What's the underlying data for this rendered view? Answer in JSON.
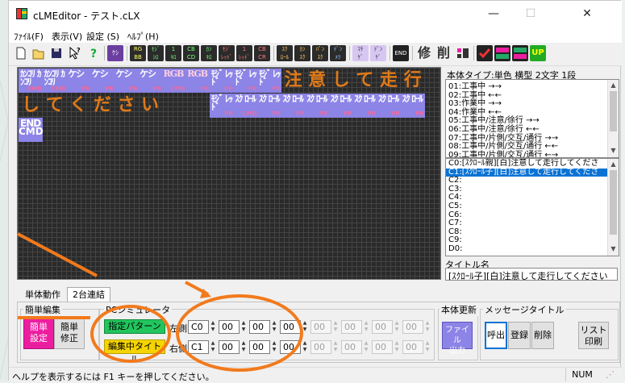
{
  "window": {
    "title": "cLMEditor - テスト.cLX",
    "minimize_glyph": "—",
    "maximize_glyph": "☐",
    "close_glyph": "✕"
  },
  "menu": [
    "ﾌｧｲﾙ(F)",
    "表示(V)",
    "設定 (S)",
    "ﾍﾙﾌﾟ(H)"
  ],
  "toolbar": {
    "icons": [
      "new-file-icon",
      "open-file-icon",
      "save-icon",
      "help-pointer-icon",
      "question-icon",
      "kesi-icon",
      "rgb-icon",
      "moji-icon",
      "one-icon",
      "cd-icon",
      "ka-icon",
      "moji-red-icon",
      "one-red-icon",
      "cr-icon",
      "scroll-icon",
      "ka-red-icon",
      "scroll-red-icon",
      "scroll-blue-icon",
      "sheet-icon",
      "end-icon",
      "edit-icon",
      "delete-icon",
      "layout-icon",
      "check-icon",
      "settings-icon",
      "down-icon",
      "up-icon"
    ],
    "end_label": "END",
    "edit_label": "修",
    "delete_label": "削",
    "up_label": "UP"
  },
  "grid_cells": [
    {
      "text": "ｶﾝｺﾘ ｶﾝｺﾘ",
      "tag": "CMD",
      "style": "p"
    },
    {
      "text": "ｶﾝｺﾘ ｶﾝｺﾘ",
      "tag": "CMD",
      "style": "p"
    },
    {
      "text": "ケシ",
      "tag": "PR",
      "style": "p"
    },
    {
      "text": "ケシ",
      "tag": "PR",
      "style": "p"
    },
    {
      "text": "ケシ",
      "tag": "PR",
      "style": "p"
    },
    {
      "text": "ケシ",
      "tag": "PR",
      "style": "p"
    },
    {
      "text": "RGB",
      "tag": "CMD",
      "style": "p rg"
    },
    {
      "text": "RGB",
      "tag": "PR",
      "style": "p rg"
    },
    {
      "text": "ﾓｼﾞ ﾚｯﾄﾞ",
      "tag": "PR",
      "style": "p"
    },
    {
      "text": "ﾓｼﾞ ﾚｯﾄﾞ",
      "tag": "PR",
      "style": "p"
    },
    {
      "text": "ﾓｼﾞ ﾚｯﾄﾞ",
      "tag": "PR",
      "style": "p"
    },
    {
      "text": "注",
      "tag": "",
      "style": "o"
    },
    {
      "text": "意",
      "tag": "",
      "style": "o"
    },
    {
      "text": "し",
      "tag": "",
      "style": "o"
    },
    {
      "text": "て",
      "tag": "",
      "style": "o"
    },
    {
      "text": "走",
      "tag": "",
      "style": "o"
    },
    {
      "text": "行",
      "tag": "",
      "style": "o"
    },
    {
      "text": "し",
      "tag": "",
      "style": "o"
    },
    {
      "text": "て",
      "tag": "",
      "style": "o"
    },
    {
      "text": "く",
      "tag": "",
      "style": "o"
    },
    {
      "text": "だ",
      "tag": "",
      "style": "o"
    },
    {
      "text": "さ",
      "tag": "",
      "style": "o"
    },
    {
      "text": "い",
      "tag": "",
      "style": "o"
    },
    {
      "text": "",
      "tag": "",
      "style": "blank"
    },
    {
      "text": "",
      "tag": "",
      "style": "blank"
    },
    {
      "text": "ﾓｼﾞ ﾚｯﾄﾞ",
      "tag": "PR",
      "style": "p"
    },
    {
      "text": "ｽｸ ﾛｰﾙ",
      "tag": "CMD",
      "style": "p"
    },
    {
      "text": "ｽｸ ﾛｰﾙ",
      "tag": "PR",
      "style": "p"
    },
    {
      "text": "ｽｸ ﾛｰﾙ",
      "tag": "PR",
      "style": "p"
    },
    {
      "text": "ｽｸ ﾛｰﾙ",
      "tag": "PR",
      "style": "p"
    },
    {
      "text": "ｽｸ ﾛｰﾙ",
      "tag": "PR",
      "style": "p"
    },
    {
      "text": "ｽｸ ﾛｰﾙ",
      "tag": "PR",
      "style": "p"
    },
    {
      "text": "ｽｸ ﾛｰﾙ",
      "tag": "PR",
      "style": "p"
    },
    {
      "text": "ｽｸ ﾛｰﾙ",
      "tag": "PR",
      "style": "p"
    },
    {
      "text": "END",
      "tag": "CMD",
      "style": "end"
    }
  ],
  "right_panel": {
    "type_label": "本体タイプ:単色 横型 2文字 1段",
    "patterns": [
      "01:工事中 →→",
      "02:工事中 ←←",
      "03:作業中 →→",
      "04:作業中 ←←",
      "05:工事中/注意/徐行 →→",
      "06:工事中/注意/徐行 ←←",
      "07:工事中/片側/交互/通行 →→",
      "08:工事中/片側/交互/通行 ←←",
      "09:工事中/片側/交互/通行 ←→"
    ],
    "titles": [
      "C0:[ｽｸﾛｰﾙ親][白]注意して走行してくださ",
      "C1:[ｽｸﾛｰﾙ子][白]注意して走行してくださ",
      "C2:",
      "C3:",
      "C4:",
      "C5:",
      "C6:",
      "C7:",
      "C8:",
      "C9:",
      "D0:"
    ],
    "title_name_label": "タイトル名",
    "title_name_value": "[ｽｸﾛｰﾙ子][白]注意して走行してください"
  },
  "tabs": [
    "単体動作",
    "2台連結"
  ],
  "simple_edit": {
    "group_label": "簡単編集",
    "settings_button": "簡単\n設定",
    "fix_button": "簡単\n修正"
  },
  "pc_sim": {
    "group_label": "PCシミュレータ",
    "specified_pattern_button": "指定パターン",
    "editing_title_button": "編集中タイトル",
    "left_label": "左側",
    "right_label": "右側",
    "left_values": [
      "C0",
      "00",
      "00",
      "00",
      "00",
      "00",
      "00",
      "00"
    ],
    "right_values": [
      "C1",
      "00",
      "00",
      "00",
      "00",
      "00",
      "00",
      "00"
    ]
  },
  "body_update": {
    "group_label": "本体更新",
    "file_output_button": "ファイル\n出力"
  },
  "message_title": {
    "group_label": "メッセージタイトル",
    "call_button": "呼出",
    "register_button": "登録",
    "delete_button": "削除",
    "list_print_button": "リスト\n印刷"
  },
  "status_bar": {
    "help_text": "ヘルプを表示するには F1 キーを押してください。",
    "num_indicator": "NUM"
  },
  "colors": {
    "accent_annotation": "#f27a1c",
    "pattern_cell": "#8c84e6",
    "led_orange": "#e07a18",
    "selection": "#0a72d4",
    "green_button": "#22c55e",
    "yellow_button": "#f5d400",
    "magenta_button": "#ec1ea0"
  }
}
